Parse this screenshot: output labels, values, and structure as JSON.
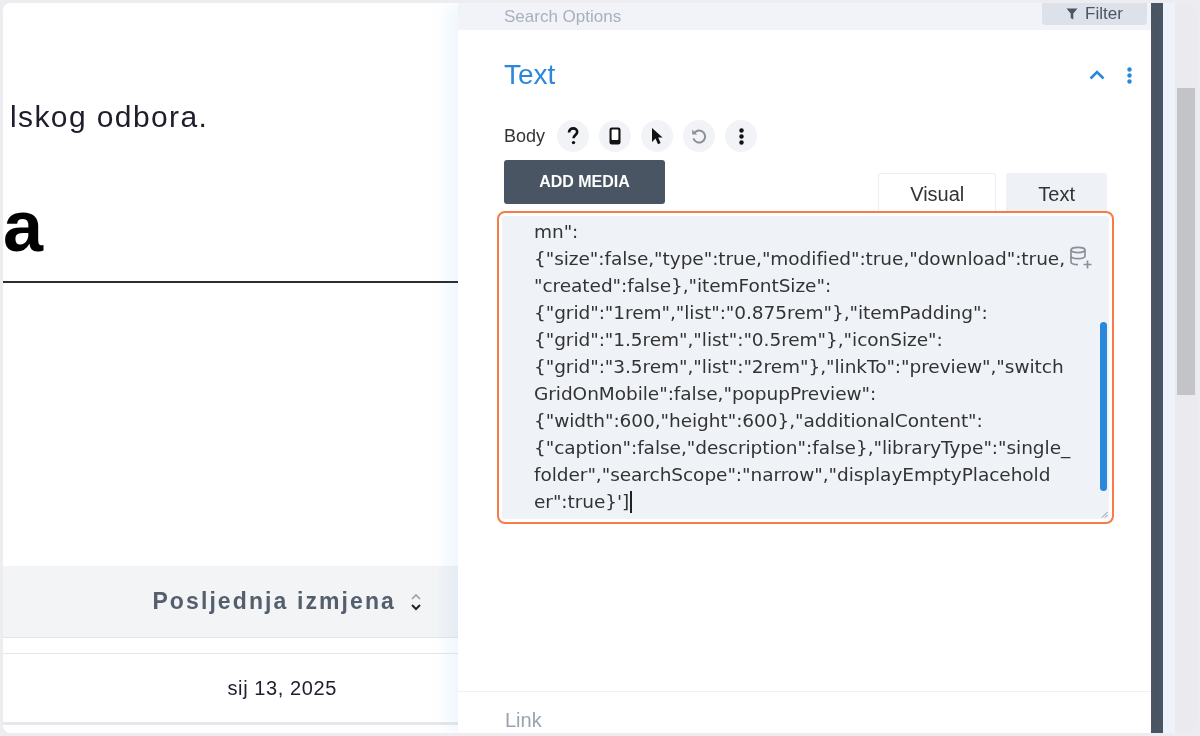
{
  "document": {
    "paragraph": "lskog odbora.",
    "heading": "a",
    "table": {
      "columns": [
        {
          "label": "Posljednja izmjena",
          "sortable": true
        }
      ],
      "rows": [
        {
          "cells": [
            "sij 13, 2025"
          ]
        }
      ]
    }
  },
  "settings_panel": {
    "search": {
      "placeholder": "Search Options"
    },
    "filter_button": {
      "label": "Filter"
    },
    "section": {
      "title": "Text",
      "expanded": true,
      "field": {
        "label": "Body",
        "tools": [
          {
            "kind": "help",
            "disabled": false
          },
          {
            "kind": "responsive",
            "disabled": false
          },
          {
            "kind": "hover",
            "disabled": false
          },
          {
            "kind": "reset",
            "disabled": true
          },
          {
            "kind": "more",
            "disabled": false
          }
        ],
        "add_media_button": "ADD MEDIA",
        "tabs": [
          {
            "label": "Visual",
            "selected": false
          },
          {
            "label": "Text",
            "selected": true
          }
        ],
        "editor": {
          "focused": true,
          "lines": [
            "mn\":",
            "{\"size\":false,\"type\":true,\"modified\":true,\"download\":true,",
            "\"created\":false},\"itemFontSize\":",
            "{\"grid\":\"1rem\",\"list\":\"0.875rem\"},\"itemPadding\":",
            "{\"grid\":\"1.5rem\",\"list\":\"0.5rem\"},\"iconSize\":",
            "{\"grid\":\"3.5rem\",\"list\":\"2rem\"},\"linkTo\":\"preview\",\"switch",
            "GridOnMobile\":false,\"popupPreview\":",
            "{\"width\":600,\"height\":600},\"additionalContent\":",
            "{\"caption\":false,\"description\":false},\"libraryType\":\"single_",
            "folder\",\"searchScope\":\"narrow\",\"displayEmptyPlacehold",
            "er\":true}']"
          ]
        }
      }
    },
    "next_section": {
      "title": "Link"
    }
  }
}
